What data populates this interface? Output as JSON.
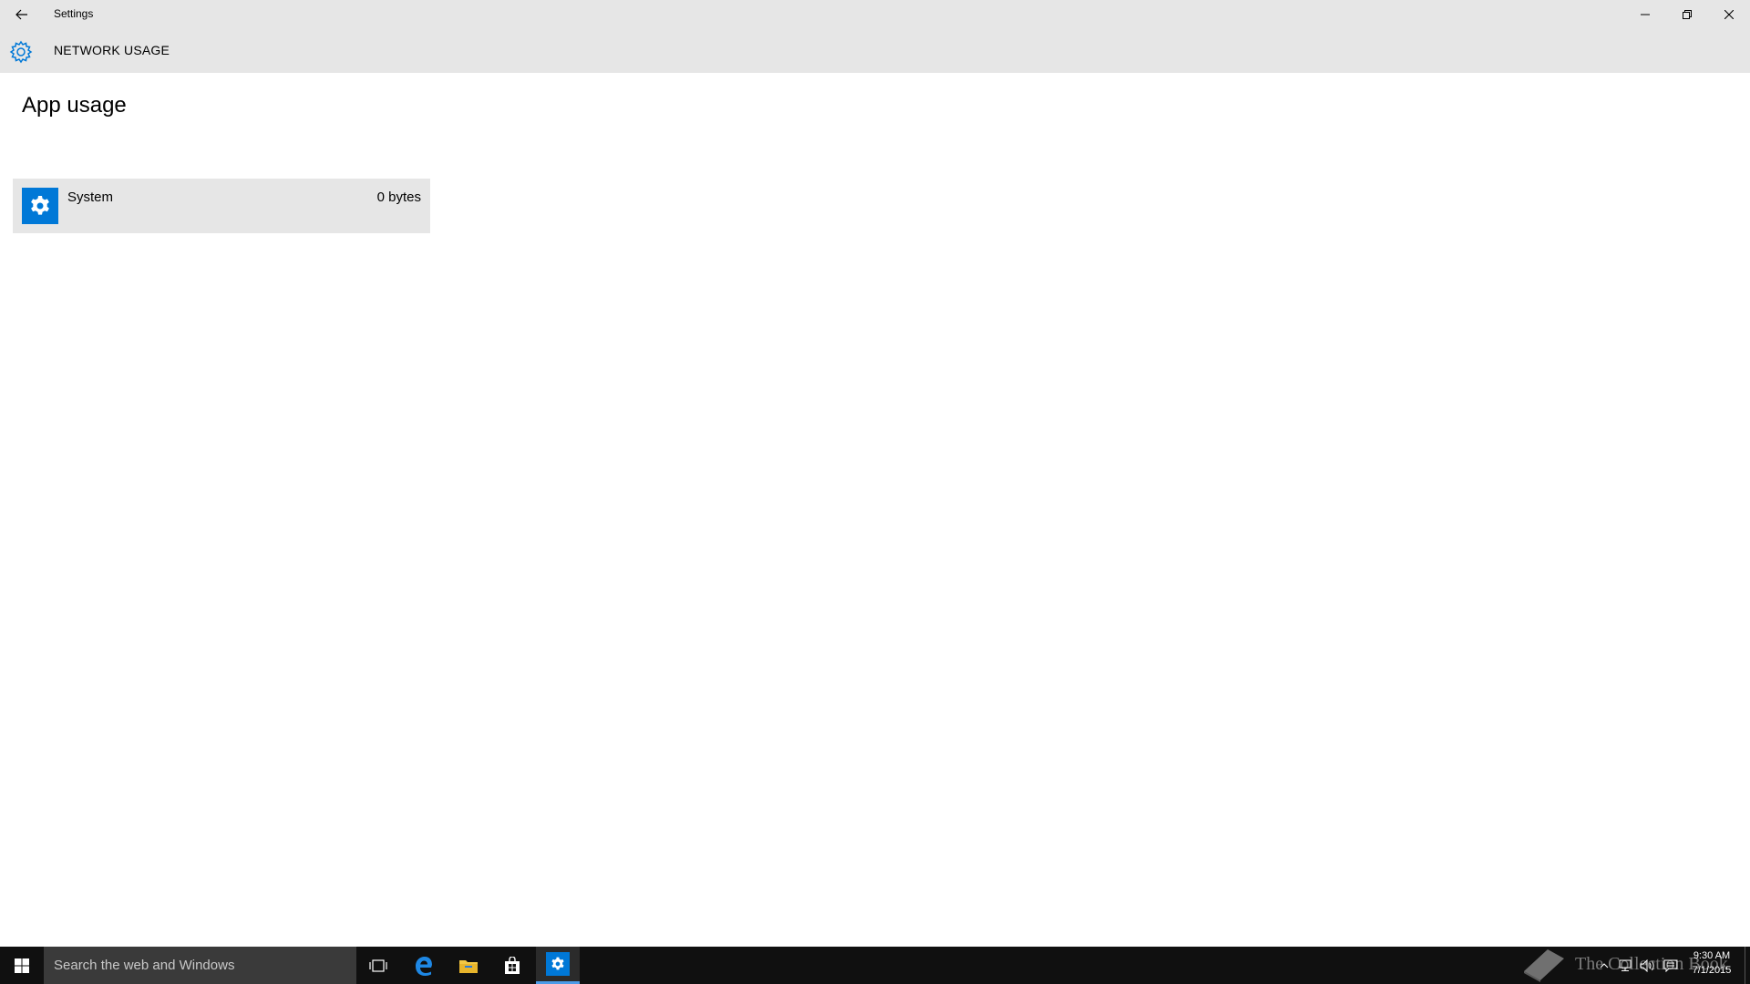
{
  "window": {
    "title": "Settings",
    "header_title": "NETWORK USAGE"
  },
  "main": {
    "heading": "App usage",
    "apps": [
      {
        "name": "System",
        "usage": "0 bytes",
        "icon": "gear-icon"
      }
    ]
  },
  "taskbar": {
    "search_placeholder": "Search the web and Windows",
    "pinned": [
      {
        "name": "task-view",
        "icon": "task-view-icon"
      },
      {
        "name": "edge",
        "icon": "edge-icon"
      },
      {
        "name": "file-explorer",
        "icon": "folder-icon"
      },
      {
        "name": "store",
        "icon": "store-icon"
      },
      {
        "name": "settings",
        "icon": "gear-icon",
        "active": true
      }
    ],
    "watermark": "The Collection Book",
    "clock": {
      "time": "9:30 AM",
      "date": "7/1/2015"
    }
  },
  "colors": {
    "accent": "#0078d7",
    "chrome": "#e6e6e6",
    "taskbar": "#101010"
  }
}
